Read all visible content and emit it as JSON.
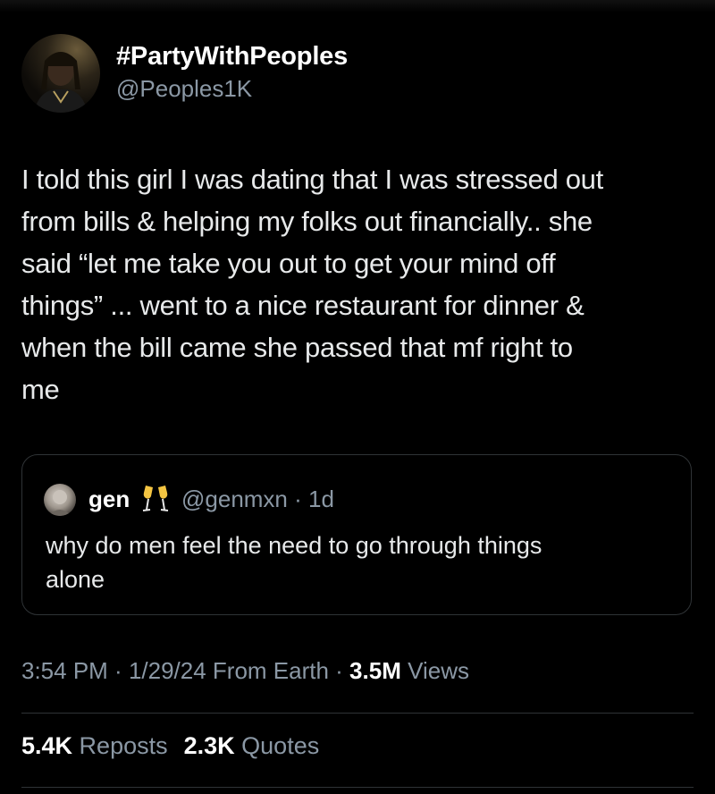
{
  "author": {
    "display_name": "#PartyWithPeoples",
    "handle": "@Peoples1K"
  },
  "tweet": {
    "text": "I told this girl I was dating that I was stressed out\nfrom bills & helping my folks out financially.. she\nsaid “let me take you out to get your mind off\nthings” ... went to a nice restaurant for dinner &\nwhen the bill came she passed that mf right to\nme"
  },
  "quoted_tweet": {
    "display_name": "gen",
    "emoji": "champagne-glasses-icon",
    "meta": "@genmxn · 1d",
    "text": "why do men feel the need to go through things\nalone"
  },
  "meta": {
    "time": "3:54 PM",
    "sep1": " · ",
    "date": "1/29/24",
    "source": " From Earth",
    "sep2": " · ",
    "views_count": "3.5M",
    "views_label": " Views"
  },
  "stats": {
    "reposts_count": "5.4K",
    "reposts_label": " Reposts",
    "quotes_count": "2.3K",
    "quotes_label": " Quotes"
  },
  "colors": {
    "background": "#000000",
    "text": "#e7e9ea",
    "secondary": "#8b98a5",
    "border": "#2f3336"
  }
}
